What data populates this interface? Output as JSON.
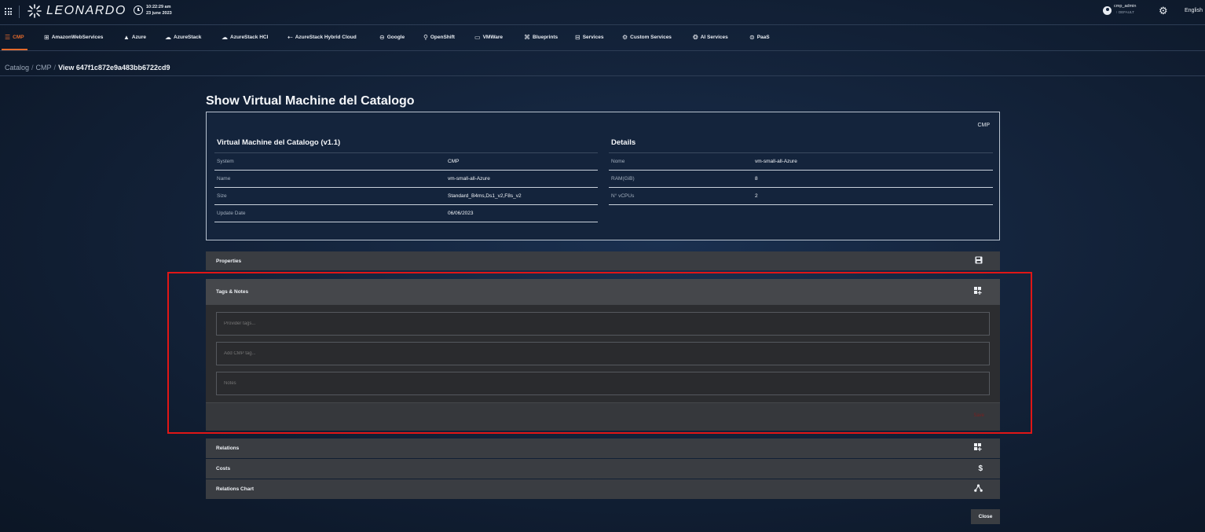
{
  "header": {
    "logo_text": "LEONARDO",
    "time": "10:22:29 am",
    "date": "23 june 2023",
    "user": "cmp_admin",
    "user_sub": "↑ DEFAULT",
    "language": "English"
  },
  "nav": [
    {
      "label": "CMP",
      "icon": "stack-icon",
      "glyph": "☰",
      "active": true
    },
    {
      "label": "AmazonWebServices",
      "icon": "grid-icon",
      "glyph": "⊞"
    },
    {
      "label": "Azure",
      "icon": "azure-icon",
      "glyph": "▲"
    },
    {
      "label": "AzureStack",
      "icon": "cloud-icon",
      "glyph": "☁"
    },
    {
      "label": "AzureStack HCI",
      "icon": "cloud-icon",
      "glyph": "☁"
    },
    {
      "label": "AzureStack Hybrid Cloud",
      "icon": "hybrid-icon",
      "glyph": "⇠"
    },
    {
      "label": "Google",
      "icon": "google-icon",
      "glyph": "⊖"
    },
    {
      "label": "OpenShift",
      "icon": "openshift-icon",
      "glyph": "⚲"
    },
    {
      "label": "VMWare",
      "icon": "monitor-icon",
      "glyph": "▭"
    },
    {
      "label": "Blueprints",
      "icon": "blueprint-icon",
      "glyph": "⌘"
    },
    {
      "label": "Services",
      "icon": "services-icon",
      "glyph": "⊟"
    },
    {
      "label": "Custom Services",
      "icon": "custom-services-icon",
      "glyph": "⚙"
    },
    {
      "label": "AI Services",
      "icon": "ai-icon",
      "glyph": "❂"
    },
    {
      "label": "PaaS",
      "icon": "paas-icon",
      "glyph": "⊜"
    }
  ],
  "breadcrumb": {
    "items": [
      "Catalog",
      "CMP"
    ],
    "current": "View 647f1c872e9a483bb6722cd9"
  },
  "page": {
    "title": "Show Virtual Machine del Catalogo",
    "tag": "CMP",
    "left_title": "Virtual Machine del Catalogo (v1.1)",
    "right_title": "Details",
    "left_rows": [
      {
        "k": "System",
        "v": "CMP"
      },
      {
        "k": "Name",
        "v": "vm-small-all-Azure"
      },
      {
        "k": "Size",
        "v": "Standard_B4ms,Ds1_v2,F8s_v2"
      },
      {
        "k": "Update Date",
        "v": "06/06/2023"
      }
    ],
    "right_rows": [
      {
        "k": "Nome",
        "v": "vm-small-all-Azure"
      },
      {
        "k": "RAM(GiB)",
        "v": "8"
      },
      {
        "k": "N° vCPUs",
        "v": "2"
      }
    ]
  },
  "sections": {
    "properties": "Properties",
    "tags_notes": "Tags & Notes",
    "provider_tags_placeholder": "Provider tags...",
    "cmp_tag_placeholder": "Add CMP tag...",
    "notes_placeholder": "Notes",
    "save": "Save",
    "relations": "Relations",
    "costs": "Costs",
    "relations_chart": "Relations Chart"
  },
  "footer": {
    "close": "Close"
  },
  "colors": {
    "accent": "#e46a2c",
    "highlight": "#e01616"
  }
}
